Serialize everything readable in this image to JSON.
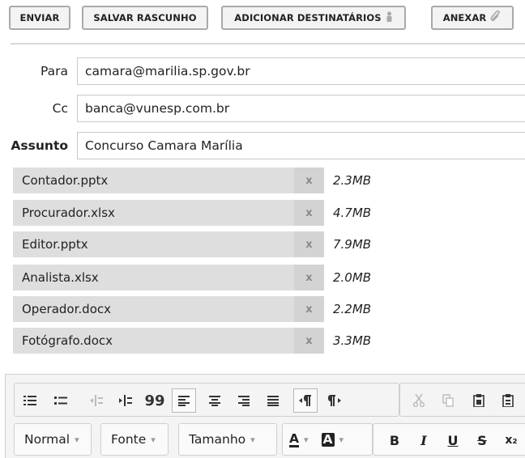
{
  "toolbar": {
    "send_label": "ENVIAR",
    "save_draft_label": "SALVAR RASCUNHO",
    "add_recipients_label": "ADICIONAR DESTINATÁRIOS",
    "attach_label": "ANEXAR"
  },
  "fields": {
    "to_label": "Para",
    "to_value": "camara@marilia.sp.gov.br",
    "cc_label": "Cc",
    "cc_value": "banca@vunesp.com.br",
    "subject_label": "Assunto",
    "subject_value": "Concurso Camara Marília"
  },
  "attachments": [
    {
      "name": "Contador.pptx",
      "size": "2.3MB",
      "remove": "x"
    },
    {
      "name": "Procurador.xlsx",
      "size": "4.7MB",
      "remove": "x"
    },
    {
      "name": "Editor.pptx",
      "size": "7.9MB",
      "remove": "x"
    },
    {
      "name": "Analista.xlsx",
      "size": "2.0MB",
      "remove": "x"
    },
    {
      "name": "Operador.docx",
      "size": "2.2MB",
      "remove": "x"
    },
    {
      "name": "Fotógrafo.docx",
      "size": "3.3MB",
      "remove": "x"
    }
  ],
  "editor": {
    "format_label": "Normal",
    "font_label": "Fonte",
    "size_label": "Tamanho",
    "text_color_glyph": "A",
    "bg_color_glyph": "A",
    "bold_glyph": "B",
    "italic_glyph": "I",
    "underline_glyph": "U",
    "strike_glyph": "S",
    "subscript_glyph": "x₂",
    "blockquote_glyph": "99"
  },
  "icons": {
    "recipients_icon": "person-icon",
    "attach_icon": "paperclip-icon"
  }
}
